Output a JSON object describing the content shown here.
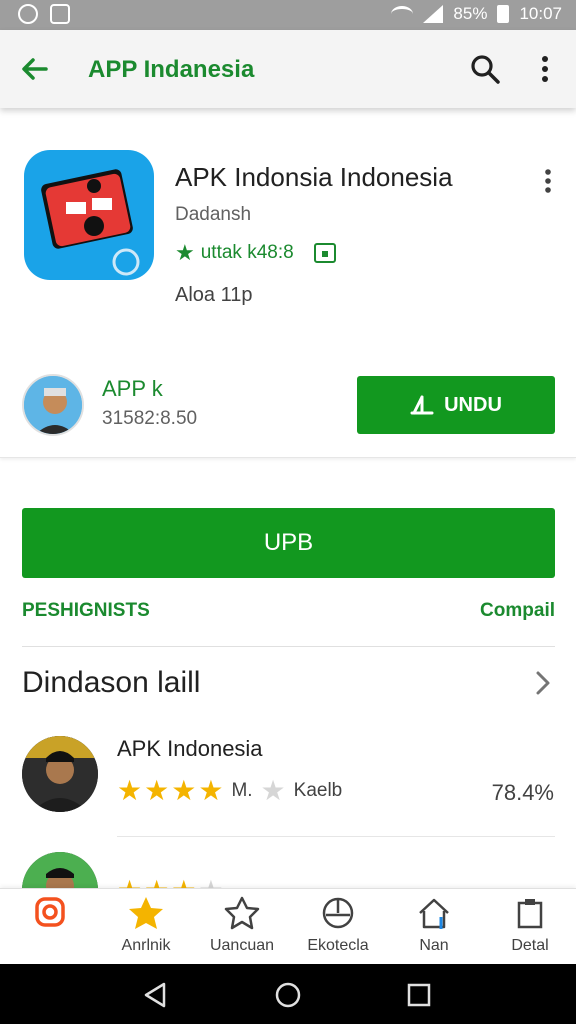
{
  "status_bar": {
    "battery": "85%",
    "time": "10:07"
  },
  "app_bar": {
    "title": "APP Indanesia",
    "back_icon": "arrow-left-icon",
    "search_icon": "search-icon",
    "more_icon": "more-vert-icon"
  },
  "app": {
    "name": "APK Indonsia Indonesia",
    "developer": "Dadansh",
    "rating_text": "uttak k48:8",
    "size_text": "Aloa  11p"
  },
  "author": {
    "name": "APP k",
    "subtitle": "31582:8.50"
  },
  "install_button": {
    "label": "UNDU"
  },
  "update_button": {
    "label": "UPB"
  },
  "section": {
    "left_label": "PESHIGNISTS",
    "right_label": "Compail"
  },
  "reviews": {
    "title": "Dindason laill",
    "items": [
      {
        "name": "APK Indonesia",
        "mid_text": "M.",
        "after_text": "Kaelb",
        "percent": "78.4%",
        "stars_on": 4
      },
      {
        "name": "",
        "mid_text": "",
        "after_text": "",
        "percent": "",
        "stars_on": 3
      }
    ]
  },
  "bottom_nav": [
    {
      "label": "",
      "icon": "instagram-icon"
    },
    {
      "label": "Anrlnik",
      "icon": "star-icon"
    },
    {
      "label": "Uancuan",
      "icon": "star-outline-icon"
    },
    {
      "label": "Ekotecla",
      "icon": "compass-icon"
    },
    {
      "label": "Nan",
      "icon": "home-icon"
    },
    {
      "label": "Detal",
      "icon": "clipboard-icon"
    }
  ],
  "colors": {
    "accent_green": "#12981f",
    "text_green": "#1b8a2f",
    "star_yellow": "#f4b400",
    "app_icon_blue": "#1aa3e8"
  }
}
